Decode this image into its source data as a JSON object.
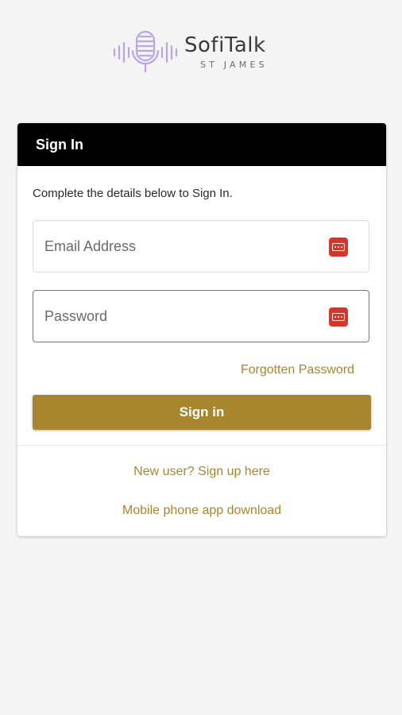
{
  "brand": {
    "name": "SofiTalk",
    "subtitle": "ST JAMES",
    "logo_color": "#b9a6e6"
  },
  "signin": {
    "header_title": "Sign In",
    "intro_text": "Complete the details below to Sign In.",
    "email_placeholder": "Email Address",
    "password_placeholder": "Password",
    "forgot_link": "Forgotten Password",
    "submit_label": "Sign in",
    "signup_link": "New user? Sign up here",
    "download_link": "Mobile phone app download"
  },
  "colors": {
    "accent": "#a8862f",
    "header_bg": "#000000",
    "password_manager_icon": "#d9342b",
    "background": "#f4f4f4"
  },
  "icons": {
    "logo": "microphone-soundwave-icon",
    "field_icon": "password-manager-icon"
  }
}
